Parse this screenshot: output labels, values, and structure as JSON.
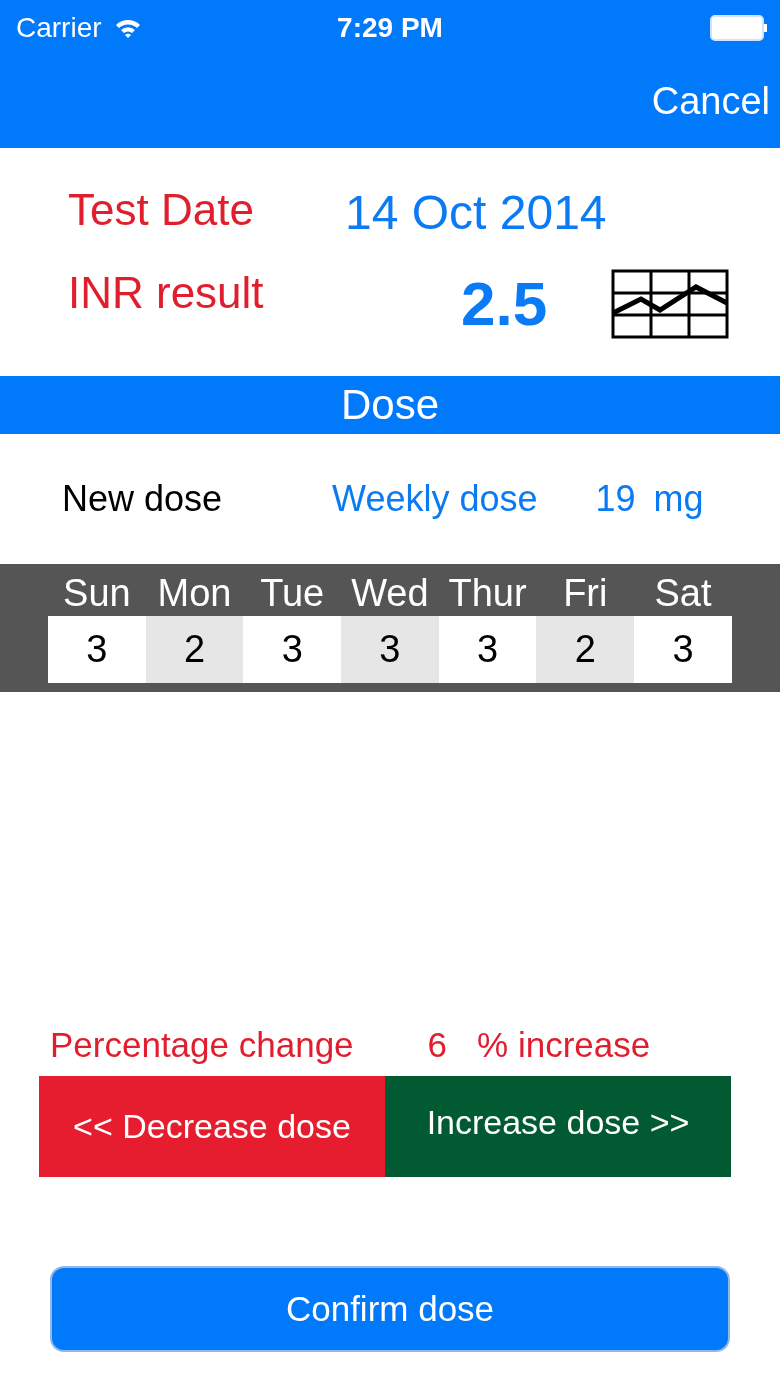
{
  "status_bar": {
    "carrier": "Carrier",
    "time": "7:29 PM"
  },
  "nav_bar": {
    "cancel": "Cancel"
  },
  "test": {
    "date_label": "Test Date",
    "date_value": "14 Oct 2014",
    "inr_label": "INR result",
    "inr_value": "2.5"
  },
  "section_title": "Dose",
  "new_dose": {
    "label": "New dose",
    "weekly_label": "Weekly dose",
    "weekly_value": "19",
    "unit": "mg"
  },
  "days": [
    {
      "day": "Sun",
      "dose": "3"
    },
    {
      "day": "Mon",
      "dose": "2"
    },
    {
      "day": "Tue",
      "dose": "3"
    },
    {
      "day": "Wed",
      "dose": "3"
    },
    {
      "day": "Thur",
      "dose": "3"
    },
    {
      "day": "Fri",
      "dose": "2"
    },
    {
      "day": "Sat",
      "dose": "3"
    }
  ],
  "change": {
    "label": "Percentage change",
    "value": "6",
    "suffix": "% increase"
  },
  "buttons": {
    "decrease": "<< Decrease dose",
    "increase": "Increase dose >>",
    "confirm": "Confirm dose"
  }
}
